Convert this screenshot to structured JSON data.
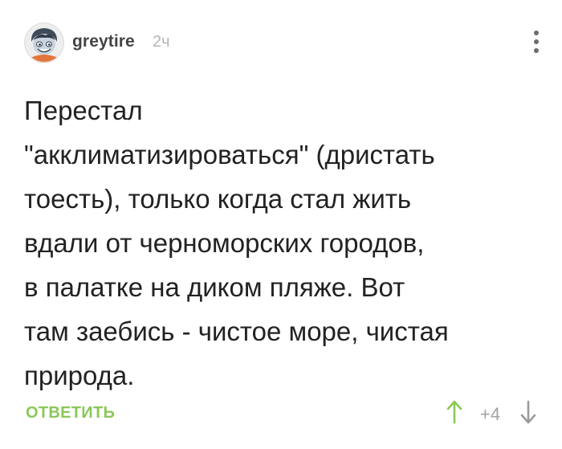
{
  "comment": {
    "author": {
      "username": "greytire",
      "avatar_icon": "cartoon-character-avatar-icon"
    },
    "time_ago": "2ч",
    "menu_icon": "vertical-ellipsis-icon",
    "body": "Перестал\n\"акклиматизироваться\" (дристать\nтоесть), только когда стал жить\nвдали от черноморских городов,\nв палатке на диком пляже. Вот\nтам заебись - чистое море, чистая\nприрода.",
    "footer": {
      "reply_label": "ОТВЕТИТЬ",
      "rating": "+4",
      "vote_up_icon": "arrow-up-icon",
      "vote_down_icon": "arrow-down-icon"
    }
  },
  "colors": {
    "reply": "#8ac858",
    "upvote": "#8ac858",
    "downvote": "#9a9a9a",
    "rating": "#a3a3a3",
    "username": "#444444",
    "timestamp": "#b5b5b5",
    "text": "#222222"
  }
}
